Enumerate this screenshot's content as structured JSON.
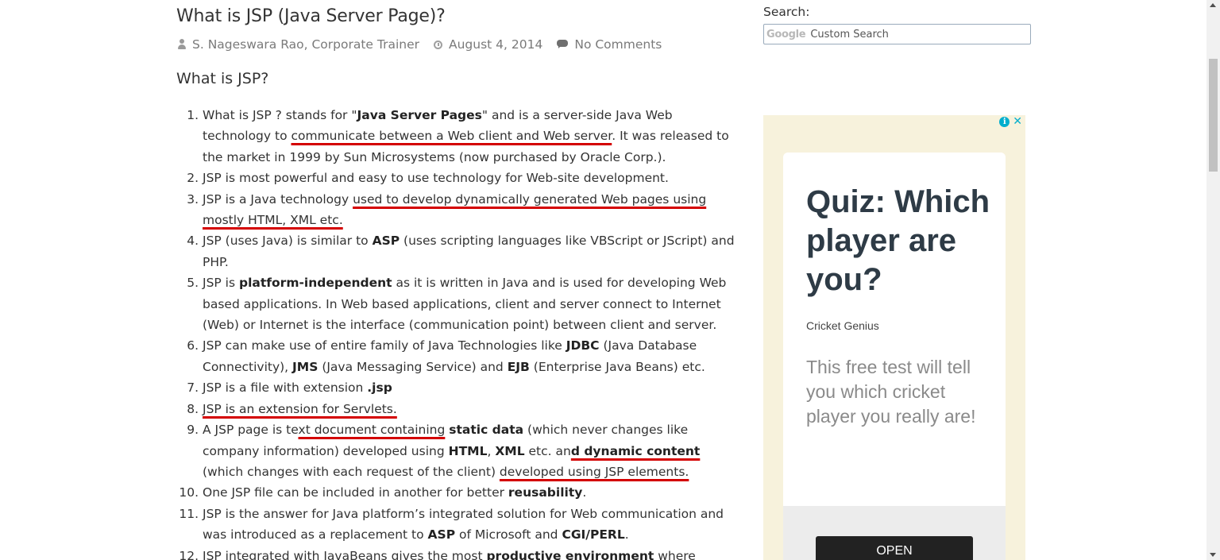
{
  "post": {
    "title": "What is JSP (Java Server Page)?",
    "author": "S. Nageswara Rao, Corporate Trainer",
    "date": "August 4, 2014",
    "comments": "No Comments",
    "subheading": "What is JSP?"
  },
  "list": [
    [
      {
        "t": "What is JSP ? stands for \""
      },
      {
        "t": "Java Server Pages",
        "b": true
      },
      {
        "t": "\" and is a server-side Java Web technology to "
      },
      {
        "t": "communicate between a Web client and Web server",
        "u": true
      },
      {
        "t": ". It was released to the market in 1999 by Sun Microsystems (now purchased by Oracle Corp.)."
      }
    ],
    [
      {
        "t": "JSP is most powerful and easy to use technology for Web-site development."
      }
    ],
    [
      {
        "t": "JSP is a Java technology "
      },
      {
        "t": "used to develop dynamically generated Web pages using mostly HTML, XML etc.",
        "u": true
      }
    ],
    [
      {
        "t": "JSP (uses Java) is similar to "
      },
      {
        "t": "ASP",
        "b": true
      },
      {
        "t": " (uses scripting languages like VBScript or JScript) and PHP."
      }
    ],
    [
      {
        "t": "JSP is "
      },
      {
        "t": "platform-independent",
        "b": true
      },
      {
        "t": " as it is written in Java and is used for developing Web based applications. In Web based applications, client and server connect to Internet (Web) or Internet is the interface (communication point) between client and server."
      }
    ],
    [
      {
        "t": "JSP can make use of entire family of Java Technologies like "
      },
      {
        "t": "JDBC",
        "b": true
      },
      {
        "t": " (Java Database Connectivity), "
      },
      {
        "t": "JMS",
        "b": true
      },
      {
        "t": " (Java Messaging Service) and "
      },
      {
        "t": "EJB",
        "b": true
      },
      {
        "t": " (Enterprise Java Beans) etc."
      }
    ],
    [
      {
        "t": "JSP is a file with extension "
      },
      {
        "t": ".jsp",
        "b": true
      }
    ],
    [
      {
        "t": "JSP is an extension for Servlets.",
        "u": true
      }
    ],
    [
      {
        "t": "A JSP page is te"
      },
      {
        "t": "xt document containing",
        "u": true
      },
      {
        "t": " "
      },
      {
        "t": "static data",
        "b": true
      },
      {
        "t": " (which never changes like company information) developed using "
      },
      {
        "t": "HTML",
        "b": true
      },
      {
        "t": ", "
      },
      {
        "t": "XML",
        "b": true
      },
      {
        "t": " etc. an"
      },
      {
        "t": "d dynamic content",
        "b": true,
        "u": true
      },
      {
        "t": " (which changes with each request of the client) "
      },
      {
        "t": "developed using JSP elements.",
        "u": true
      }
    ],
    [
      {
        "t": "One JSP file can be included in another for better "
      },
      {
        "t": "reusability",
        "b": true
      },
      {
        "t": "."
      }
    ],
    [
      {
        "t": "JSP is the answer for Java platform’s integrated solution for Web communication and was introduced as a replacement to "
      },
      {
        "t": "ASP",
        "b": true
      },
      {
        "t": " of Microsoft and "
      },
      {
        "t": "CGI/PERL",
        "b": true
      },
      {
        "t": "."
      }
    ],
    [
      {
        "t": "JSP integrated with JavaBeans gives the most "
      },
      {
        "t": "productive environment",
        "b": true
      },
      {
        "t": " where reusability"
      }
    ]
  ],
  "sidebar": {
    "search_label": "Search:",
    "search_brand": "Google",
    "search_placeholder": "Custom Search"
  },
  "ad": {
    "info_glyph": "i",
    "close_glyph": "✕",
    "headline": "Quiz: Which player are you?",
    "source": "Cricket Genius",
    "body": "This free test will tell you which cricket player you really are!",
    "cta": "OPEN"
  },
  "colors": {
    "underline": "#d40000",
    "ad_bg": "#f7f2dc",
    "ad_accent": "#00aecd"
  }
}
